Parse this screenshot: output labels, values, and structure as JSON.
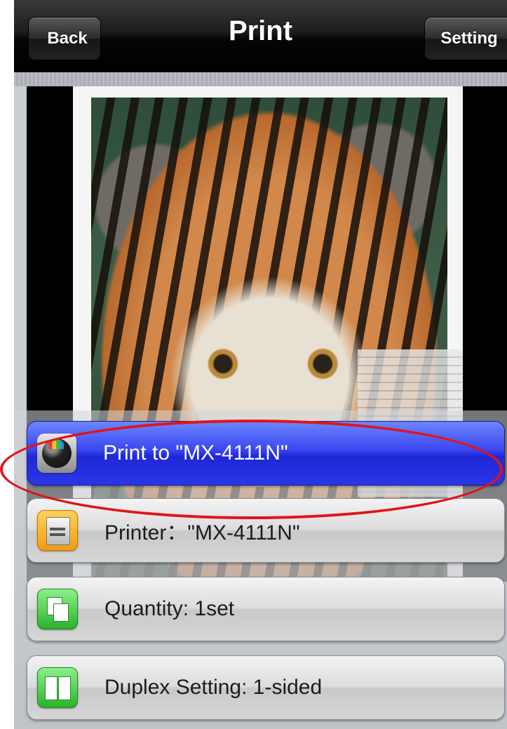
{
  "nav": {
    "title": "Print",
    "back_label": "Back",
    "setting_label": "Setting"
  },
  "preview": {
    "image": "tiger-photo"
  },
  "options": [
    {
      "label": "Print to \"MX-4111N\"",
      "icon": "print-icon",
      "selected": true
    },
    {
      "label": "Printer：\"MX-4111N\"",
      "icon": "printer-icon"
    },
    {
      "label": "Quantity: 1set",
      "icon": "quantity-icon"
    },
    {
      "label": "Duplex Setting: 1-sided",
      "icon": "duplex-icon"
    }
  ],
  "colors": {
    "selected_row": "#2a36e8",
    "annotation": "#e0141b"
  }
}
